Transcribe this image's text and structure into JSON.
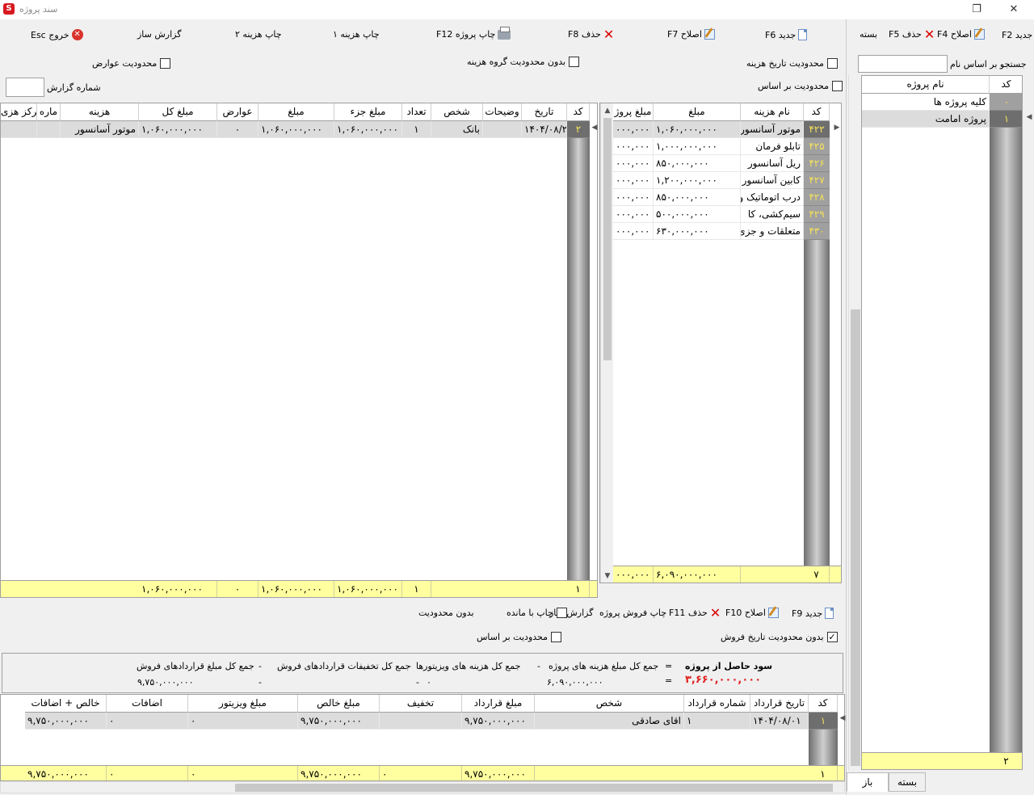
{
  "window": {
    "title": "سند پروژه",
    "logo": "S"
  },
  "left_panel": {
    "toolbar": {
      "new": "جدید F2",
      "edit": "اصلاح F4",
      "delete": "حذف F5",
      "close": "بسته"
    },
    "search_label": "جستجو بر اساس نام",
    "search_value": "",
    "grid": {
      "headers": {
        "code": "کد",
        "name": "نام پروژه"
      },
      "rows": [
        {
          "code": "۰",
          "name": "کلیه پروژه ها"
        },
        {
          "code": "۱",
          "name": "پروژه امامت"
        }
      ],
      "total_count": "۲"
    },
    "tabs": {
      "open": "باز",
      "closed": "بسته"
    }
  },
  "top_toolbar": {
    "new": "جدید F6",
    "edit": "اصلاح F7",
    "delete": "حذف F8",
    "print_project": "چاپ پروژه F12",
    "print_cost1": "چاپ هزینه ۱",
    "print_cost2": "چاپ هزینه ۲",
    "report_builder": "گزارش ساز",
    "exit": "خروج Esc"
  },
  "filters": {
    "date_limit": "محدودیت تاریخ هزینه",
    "no_group_limit": "بدون محدودیت گروه هزینه",
    "fee_limit": "محدودیت عوارض",
    "basis_limit": "محدودیت بر اساس",
    "report_no_label": "شماره گزارش",
    "report_no_value": ""
  },
  "cost_grid": {
    "headers": {
      "code": "کد",
      "name": "نام هزینه",
      "amount": "مبلغ",
      "project_amount": "مبلغ پروژ"
    },
    "rows": [
      {
        "code": "۴۲۲",
        "name": "موتور آسانسور",
        "amount": "۱,۰۶۰,۰۰۰,۰۰۰",
        "project_amount": "۰۰۰,۰۰۰"
      },
      {
        "code": "۴۲۵",
        "name": "تابلو فرمان",
        "amount": "۱,۰۰۰,۰۰۰,۰۰۰",
        "project_amount": "۰۰۰,۰۰۰"
      },
      {
        "code": "۴۲۶",
        "name": "ریل آسانسور",
        "amount": "۸۵۰,۰۰۰,۰۰۰",
        "project_amount": "۰۰۰,۰۰۰"
      },
      {
        "code": "۴۲۷",
        "name": "کابین آسانسور",
        "amount": "۱,۲۰۰,۰۰۰,۰۰۰",
        "project_amount": "۰۰۰,۰۰۰"
      },
      {
        "code": "۴۲۸",
        "name": "درب اتوماتیک و",
        "amount": "۸۵۰,۰۰۰,۰۰۰",
        "project_amount": "۰۰۰,۰۰۰"
      },
      {
        "code": "۴۲۹",
        "name": "سیم‌کشی، کا",
        "amount": "۵۰۰,۰۰۰,۰۰۰",
        "project_amount": "۰۰۰,۰۰۰"
      },
      {
        "code": "۴۳۰",
        "name": "متعلقات و جزئ",
        "amount": "۶۳۰,۰۰۰,۰۰۰",
        "project_amount": "۰۰۰,۰۰۰"
      }
    ],
    "totals": {
      "count": "۷",
      "amount": "۶,۰۹۰,۰۰۰,۰۰۰",
      "project_amount": "۰۰۰,۰۰۰"
    }
  },
  "detail_grid": {
    "headers": {
      "code": "کد",
      "date": "تاریخ",
      "desc": "وضیحات",
      "person": "شخص",
      "qty": "تعداد",
      "unit": "مبلغ جزء",
      "amount": "مبلغ",
      "fees": "عوارض",
      "total": "مبلغ کل",
      "cost": "هزینه",
      "num": "ماره",
      "center": "مرکز هزی"
    },
    "rows": [
      {
        "code": "۲",
        "date": "۱۴۰۴/۰۸/۲",
        "desc": "",
        "person": "بانک",
        "qty": "۱",
        "unit": "۱,۰۶۰,۰۰۰,۰۰۰",
        "amount": "۱,۰۶۰,۰۰۰,۰۰۰",
        "fees": "۰",
        "total": "۱,۰۶۰,۰۰۰,۰۰۰",
        "cost": "موتور آسانسور"
      }
    ],
    "totals": {
      "count": "۱",
      "qty": "۱",
      "unit": "۱,۰۶۰,۰۰۰,۰۰۰",
      "amount": "۱,۰۶۰,۰۰۰,۰۰۰",
      "fees": "۰",
      "total": "۱,۰۶۰,۰۰۰,۰۰۰"
    }
  },
  "sales_toolbar": {
    "new": "جدید F9",
    "edit": "اصلاح F10",
    "delete": "حذف F11",
    "print_sales": "چاپ فروش پروژه",
    "report_builder": "گزارش ساز",
    "print_remaining": "چاپ با مانده",
    "no_limit": "بدون محدودیت",
    "no_date_limit": "بدون محدودیت تاریخ فروش",
    "basis_limit": "محدودیت بر اساس"
  },
  "summary": {
    "profit_label": "سود حاصل از پروژه",
    "eq": "=",
    "profit_value": "۳,۶۶۰,۰۰۰,۰۰۰",
    "total_contracts_label": "جمع کل مبلغ قراردادهای فروش",
    "total_contracts_value": "۹,۷۵۰,۰۰۰,۰۰۰",
    "discounts_label": "جمع کل تخفیفات قراردادهای فروش",
    "discounts_value": "۰",
    "visitors_label": "جمع کل هزینه های ویزیتورها",
    "visitors_value": "-",
    "project_costs_label": "جمع کل مبلغ هزینه های پروژه",
    "project_costs_value": "۶,۰۹۰,۰۰۰,۰۰۰",
    "minus": "-"
  },
  "sales_grid": {
    "headers": {
      "code": "کد",
      "date": "تاریخ قرارداد",
      "number": "شماره قرارداد",
      "person": "شخص",
      "contract": "مبلغ قرارداد",
      "discount": "تخفیف",
      "net": "مبلغ خالص",
      "visitor": "مبلغ ویزیتور",
      "extras": "اضافات",
      "net_extras": "خالص + اضافات"
    },
    "rows": [
      {
        "code": "۱",
        "date": "۱۴۰۴/۰۸/۰۱",
        "number": "۱",
        "person": "اقای صادقی",
        "contract": "۹,۷۵۰,۰۰۰,۰۰۰",
        "discount": "",
        "net": "۹,۷۵۰,۰۰۰,۰۰۰",
        "visitor": "۰",
        "extras": "۰",
        "net_extras": "۹,۷۵۰,۰۰۰,۰۰۰"
      }
    ],
    "totals": {
      "count": "۱",
      "contract": "۹,۷۵۰,۰۰۰,۰۰۰",
      "discount": "۰",
      "net": "۹,۷۵۰,۰۰۰,۰۰۰",
      "visitor": "۰",
      "extras": "۰",
      "net_extras": "۹,۷۵۰,۰۰۰,۰۰۰"
    }
  }
}
